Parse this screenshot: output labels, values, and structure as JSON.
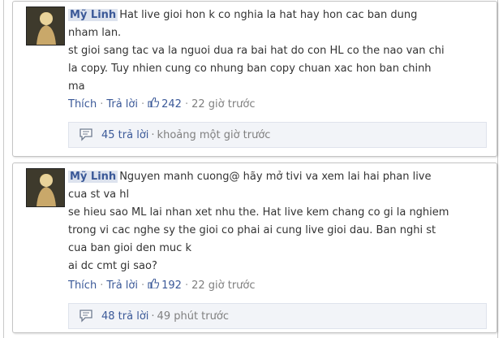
{
  "comments": [
    {
      "author": "Mỹ Linh",
      "lines": [
        "Hat live gioi hon k co nghia la hat hay hon cac ban dung",
        "nham lan.",
        "st gioi sang tac va la nguoi dua ra bai hat do con HL co the nao van chi",
        "la copy. Tuy nhien cung co nhung ban copy chuan xac hon ban chinh",
        "ma"
      ],
      "like_label": "Thích",
      "reply_label": "Trả lời",
      "like_count": "242",
      "time": "22 giờ trước",
      "replies_count": "45 trả lời",
      "replies_time": "khoảng một giờ trước"
    },
    {
      "author": "Mỹ Linh",
      "lines": [
        "Nguyen manh cuong@ hãy mở tivi va xem lai hai phan live",
        "cua st va hl",
        "se hieu sao ML lai nhan xet nhu the. Hat live kem chang co gi la nghiem",
        "trong vi cac nghe sy the gioi co phai ai cung live gioi dau. Ban nghi st",
        "cua ban gioi den muc k",
        "ai dc cmt gi sao?"
      ],
      "like_label": "Thích",
      "reply_label": "Trả lời",
      "like_count": "192",
      "time": "22 giờ trước",
      "replies_count": "48 trả lời",
      "replies_time": "49 phút trước"
    }
  ],
  "colors": {
    "link": "#3b5998",
    "meta": "#7f7f7f",
    "reply_bg": "#f2f4f8"
  },
  "icons": {
    "like": "thumbs-up-icon",
    "replies": "speech-bubble-icon"
  }
}
